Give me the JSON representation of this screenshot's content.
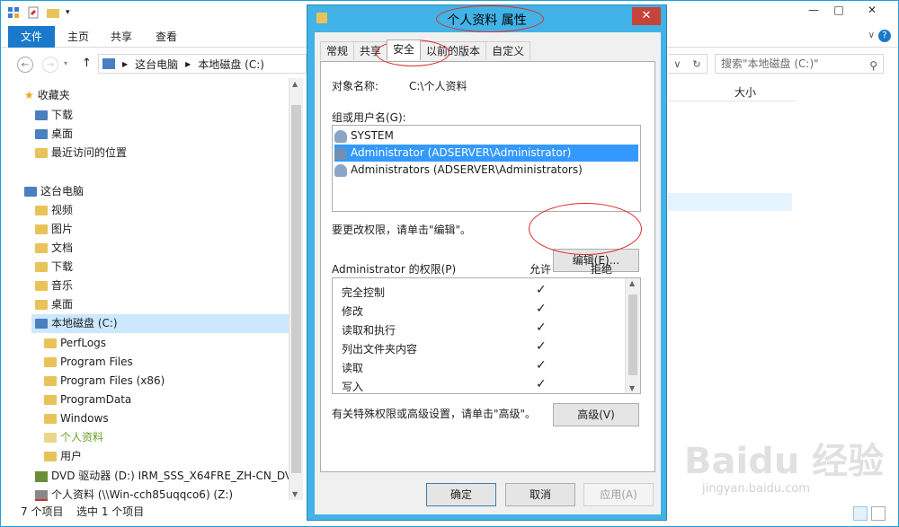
{
  "explorer": {
    "ribbon_tabs": [
      "文件",
      "主页",
      "共享",
      "查看"
    ],
    "breadcrumb": [
      "这台电脑",
      "本地磁盘 (C:)"
    ],
    "search_placeholder": "搜索\"本地磁盘 (C:)\"",
    "column_size": "大小",
    "nav_items": [
      {
        "label": "收藏夹"
      },
      {
        "label": "下载"
      },
      {
        "label": "桌面"
      },
      {
        "label": "最近访问的位置"
      },
      {
        "label": "这台电脑"
      },
      {
        "label": "视频"
      },
      {
        "label": "图片"
      },
      {
        "label": "文档"
      },
      {
        "label": "下载"
      },
      {
        "label": "音乐"
      },
      {
        "label": "桌面"
      },
      {
        "label": "本地磁盘 (C:)"
      },
      {
        "label": "PerfLogs"
      },
      {
        "label": "Program Files"
      },
      {
        "label": "Program Files (x86)"
      },
      {
        "label": "ProgramData"
      },
      {
        "label": "Windows"
      },
      {
        "label": "个人资料"
      },
      {
        "label": "用户"
      },
      {
        "label": "DVD 驱动器 (D:) IRM_SSS_X64FRE_ZH-CN_DV5"
      },
      {
        "label": "个人资料 (\\\\Win-cch85uqqco6) (Z:)"
      }
    ],
    "status_count": "7 个项目",
    "status_selected": "选中 1 个项目"
  },
  "dialog": {
    "title": "个人资料 属性",
    "close": "✕",
    "tabs": [
      "常规",
      "共享",
      "安全",
      "以前的版本",
      "自定义"
    ],
    "object_label": "对象名称:",
    "object_value": "C:\\个人资料",
    "group_label": "组或用户名(G):",
    "users": [
      "SYSTEM",
      "Administrator (ADSERVER\\Administrator)",
      "Administrators (ADSERVER\\Administrators)"
    ],
    "change_hint": "要更改权限，请单击\"编辑\"。",
    "edit_button": "编辑(E)...",
    "perm_label": "Administrator 的权限(P)",
    "allow": "允许",
    "deny": "拒绝",
    "permissions": [
      {
        "name": "完全控制",
        "allow": "✓"
      },
      {
        "name": "修改",
        "allow": "✓"
      },
      {
        "name": "读取和执行",
        "allow": "✓"
      },
      {
        "name": "列出文件夹内容",
        "allow": "✓"
      },
      {
        "name": "读取",
        "allow": "✓"
      },
      {
        "name": "写入",
        "allow": "✓"
      }
    ],
    "advanced_hint": "有关特殊权限或高级设置，请单击\"高级\"。",
    "advanced_button": "高级(V)",
    "ok_button": "确定",
    "cancel_button": "取消",
    "apply_button": "应用(A)"
  },
  "watermark": {
    "main": "Baidu 经验",
    "sub": "jingyan.baidu.com"
  }
}
